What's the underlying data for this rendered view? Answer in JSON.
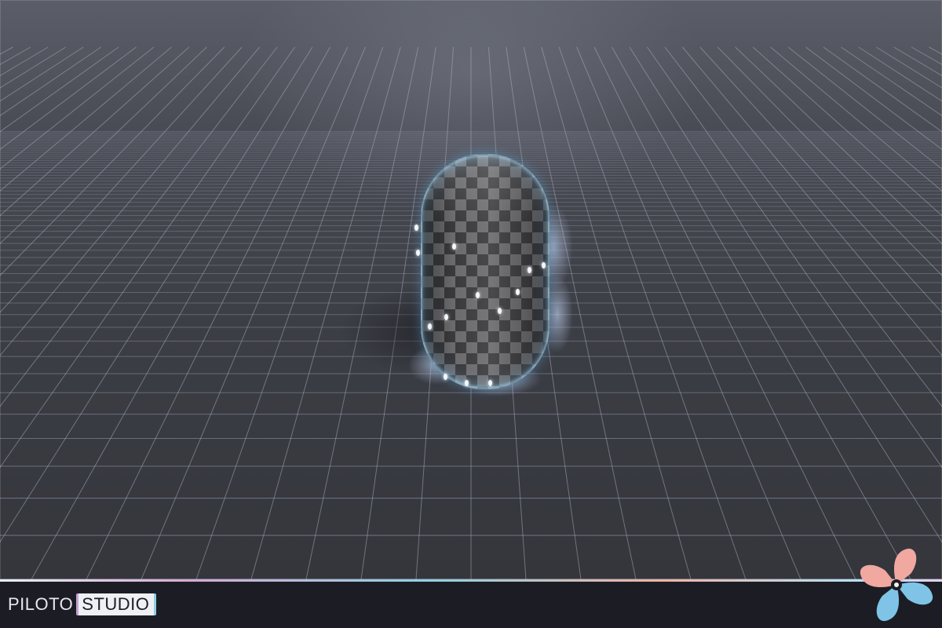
{
  "brand": {
    "name": "PILOTO",
    "tag": "STUDIO"
  },
  "colors": {
    "grid_line": "#aab2c4",
    "capsule_glow": "#78c8ff",
    "logo_pink": "#f0a8a0",
    "logo_blue": "#7fc4e6",
    "bar_bg": "#1c1d24"
  },
  "icons": {
    "logo": "propeller-fan-icon"
  }
}
